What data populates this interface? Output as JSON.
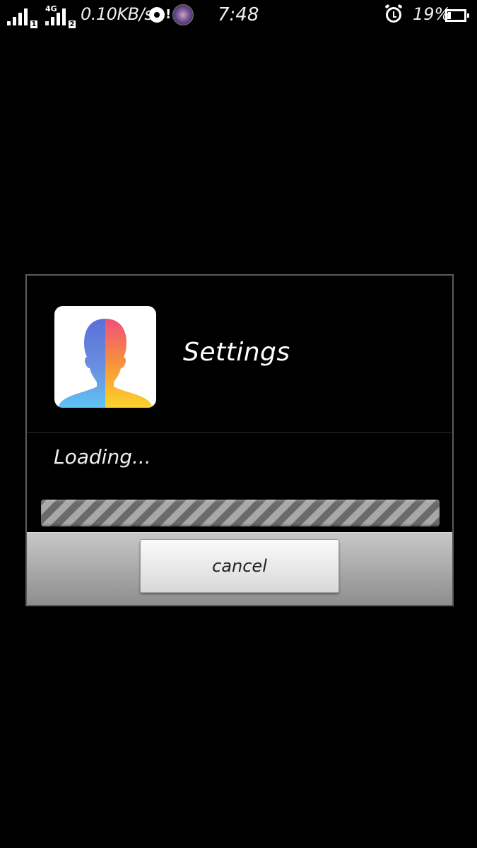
{
  "status_bar": {
    "network_type": "4G",
    "sim1_label": "1",
    "sim2_label": "2",
    "speed": "0.10KB/s",
    "notification_mark": "!",
    "time": "7:48",
    "battery_percent_text": "19%",
    "battery_level": 0.19,
    "icons": [
      "signal-sim1-icon",
      "signal-sim2-icon",
      "disc-icon",
      "alert-icon",
      "app-notification-icon",
      "alarm-icon",
      "battery-icon"
    ]
  },
  "dialog": {
    "app_icon": "faceapp-profile-icon",
    "title": "Settings",
    "message": "Loading...",
    "progress": "indeterminate",
    "cancel_label": "cancel"
  },
  "colors": {
    "background": "#000000",
    "dialog_border": "#5a5a5a",
    "footer_top": "#c8c8c8",
    "footer_bottom": "#8e8e8e",
    "progress_dark": "#6a6a6a",
    "progress_light": "#a8a8a8",
    "icon_blue": "#5b6fd8",
    "icon_pink": "#ef4f7a",
    "icon_orange": "#f7923c",
    "icon_yellow": "#fbd42a",
    "icon_light_blue": "#5ec4f4"
  }
}
